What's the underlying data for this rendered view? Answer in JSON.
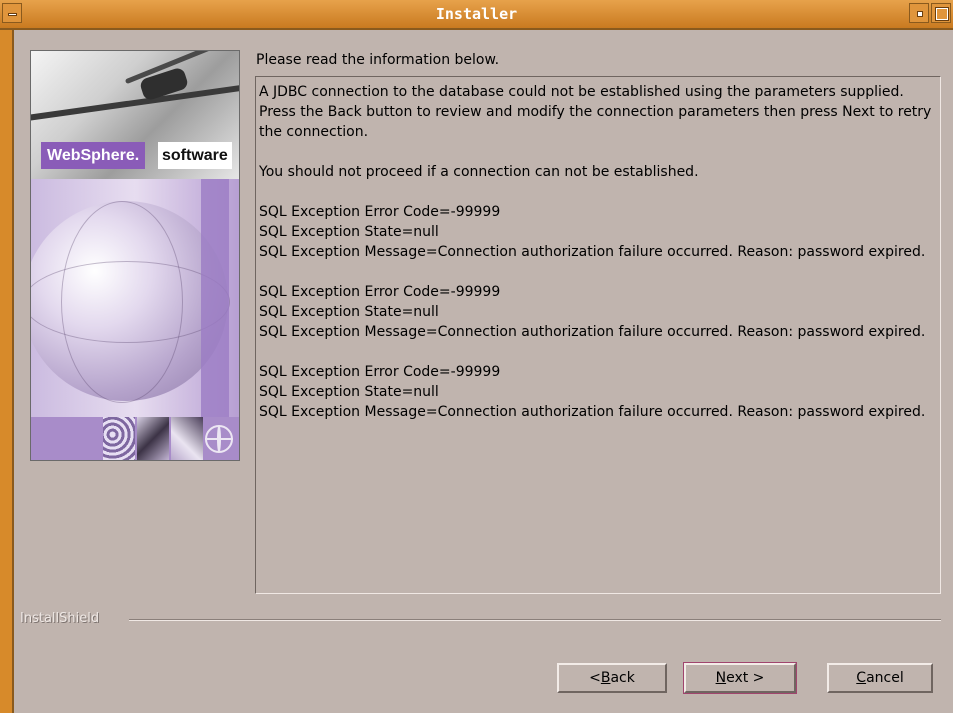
{
  "window": {
    "title": "Installer",
    "accent_color": "#d78a2a",
    "body_color": "#c0b4ae"
  },
  "banner": {
    "brand_name": "WebSphere.",
    "brand_suffix": "software",
    "brand_color": "#8a5cb8"
  },
  "main": {
    "instruction": "Please read the information below.",
    "message_lines": [
      "A JDBC connection to the database could not be established using the parameters supplied.",
      "Press the Back button to review and modify the connection parameters then press Next to retry the connection.",
      "",
      "You should not proceed if a connection can not be established.",
      "",
      "SQL Exception Error Code=-99999",
      "SQL Exception State=null",
      "SQL Exception Message=Connection authorization failure occurred. Reason: password expired.",
      "",
      "SQL Exception Error Code=-99999",
      "SQL Exception State=null",
      "SQL Exception Message=Connection authorization failure occurred. Reason: password expired.",
      "",
      "SQL Exception Error Code=-99999",
      "SQL Exception State=null",
      "SQL Exception Message=Connection authorization failure occurred. Reason: password expired."
    ]
  },
  "footer": {
    "vendor_label": "InstallShield",
    "back_button": {
      "mnemonic": "B",
      "prefix": "< ",
      "rest": "ack"
    },
    "next_button": {
      "mnemonic": "N",
      "prefix": "",
      "rest": "ext >"
    },
    "cancel_button": {
      "mnemonic": "C",
      "prefix": "",
      "rest": "ancel"
    }
  }
}
